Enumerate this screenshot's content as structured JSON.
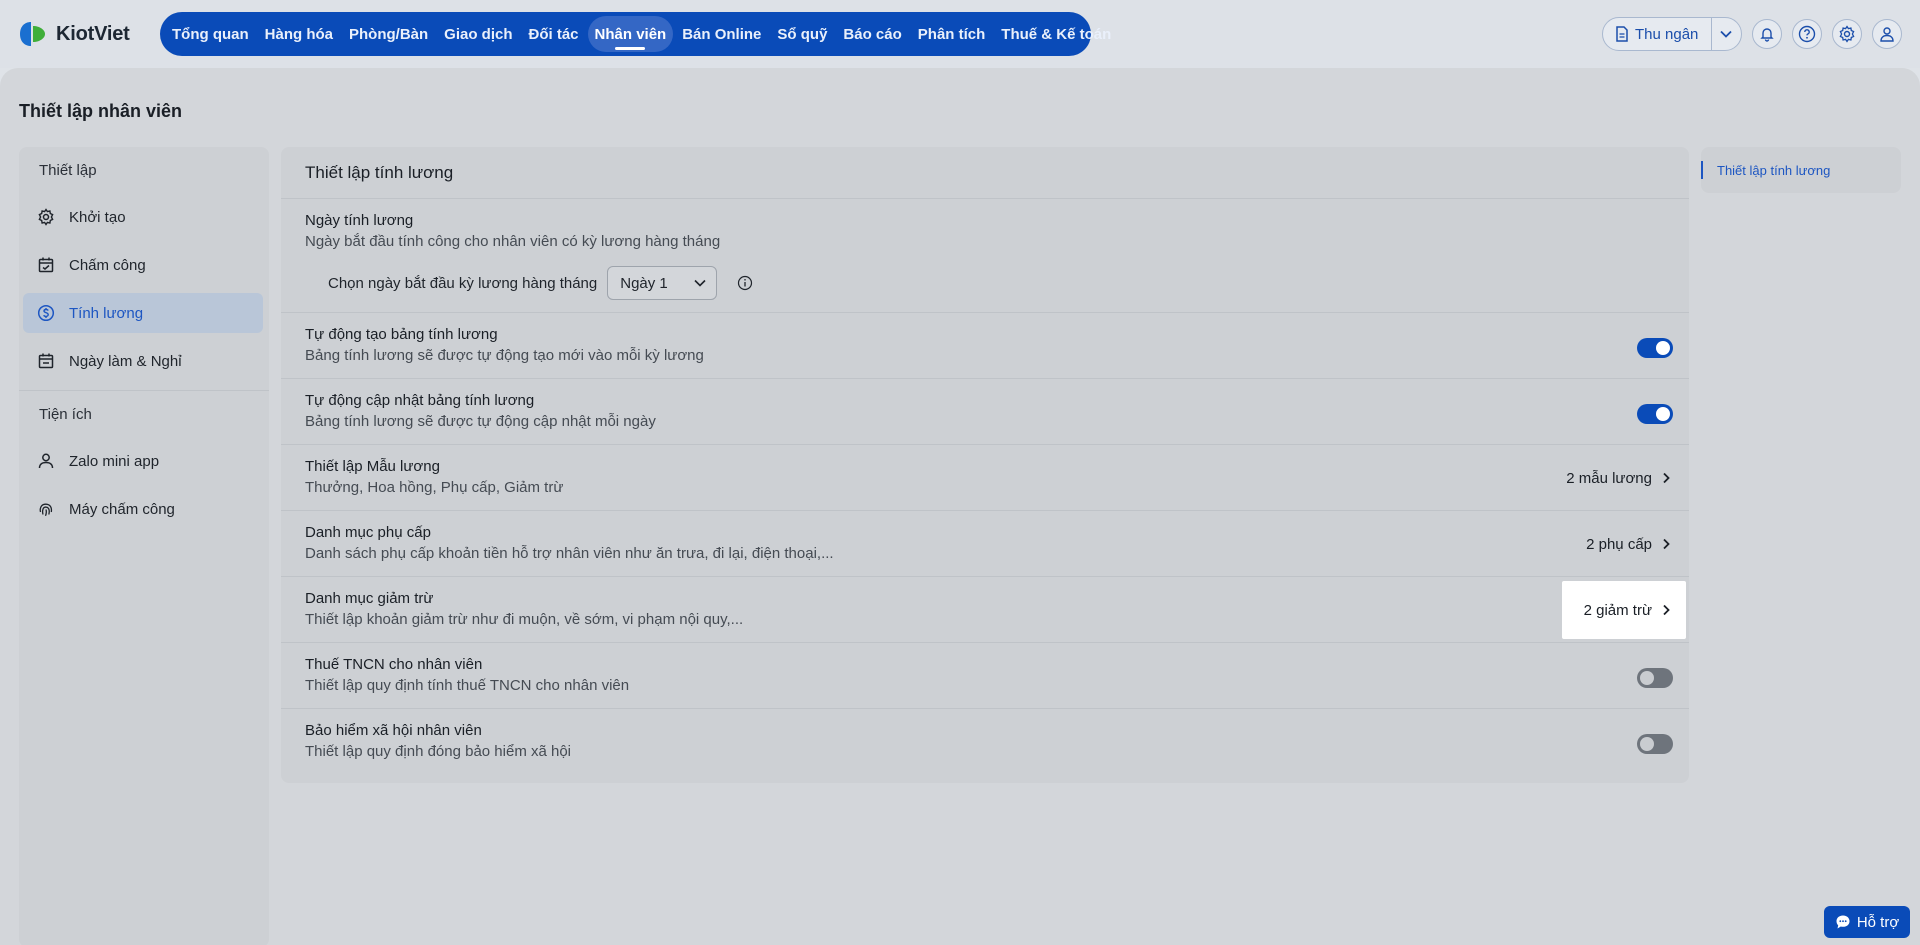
{
  "app": {
    "brand": "KiotViet"
  },
  "nav": {
    "items": [
      {
        "label": "Tổng quan"
      },
      {
        "label": "Hàng hóa"
      },
      {
        "label": "Phòng/Bàn"
      },
      {
        "label": "Giao dịch"
      },
      {
        "label": "Đối tác"
      },
      {
        "label": "Nhân viên",
        "active": true
      },
      {
        "label": "Bán Online"
      },
      {
        "label": "Sổ quỹ"
      },
      {
        "label": "Báo cáo"
      },
      {
        "label": "Phân tích"
      },
      {
        "label": "Thuế & Kế toán"
      }
    ]
  },
  "toolbar": {
    "cashier_label": "Thu ngân",
    "icons": [
      "bell-icon",
      "help-icon",
      "gear-icon",
      "user-icon"
    ]
  },
  "page": {
    "title": "Thiết lập nhân viên"
  },
  "sidebar": {
    "section_setup": "Thiết lập",
    "setup_items": [
      {
        "label": "Khởi tạo",
        "icon": "gear-icon"
      },
      {
        "label": "Chấm công",
        "icon": "calendar-check-icon"
      },
      {
        "label": "Tính lương",
        "icon": "dollar-circle-icon",
        "active": true
      },
      {
        "label": "Ngày làm & Nghỉ",
        "icon": "calendar-icon"
      }
    ],
    "section_utilities": "Tiện ích",
    "utility_items": [
      {
        "label": "Zalo mini app",
        "icon": "user-icon"
      },
      {
        "label": "Máy chấm công",
        "icon": "fingerprint-icon"
      }
    ]
  },
  "payroll": {
    "header": "Thiết lập tính lương",
    "payday": {
      "title": "Ngày tính lương",
      "desc": "Ngày bắt đầu tính công cho nhân viên có kỳ lương hàng tháng",
      "select_label": "Chọn ngày bắt đầu kỳ lương hàng tháng",
      "select_value": "Ngày 1"
    },
    "auto_create": {
      "title": "Tự động tạo bảng tính lương",
      "desc": "Bảng tính lương sẽ được tự động tạo mới vào mỗi kỳ lương",
      "enabled": true
    },
    "auto_update": {
      "title": "Tự động cập nhật bảng tính lương",
      "desc": "Bảng tính lương sẽ được tự động cập nhật mỗi ngày",
      "enabled": true
    },
    "templates": {
      "title": "Thiết lập Mẫu lương",
      "desc": "Thưởng, Hoa hồng, Phụ cấp, Giảm trừ",
      "action": "2 mẫu lương"
    },
    "allowances": {
      "title": "Danh mục phụ cấp",
      "desc": "Danh sách phụ cấp khoản tiền hỗ trợ nhân viên như ăn trưa, đi lại, điện thoại,...",
      "action": "2 phụ cấp"
    },
    "deductions": {
      "title": "Danh mục giảm trừ",
      "desc": "Thiết lập khoản giảm trừ như đi muộn, về sớm, vi phạm nội quy,...",
      "action": "2 giảm trừ"
    },
    "income_tax": {
      "title": "Thuế TNCN cho nhân viên",
      "desc": "Thiết lập quy định tính thuế TNCN cho nhân viên",
      "enabled": false
    },
    "insurance": {
      "title": "Bảo hiểm xã hội nhân viên",
      "desc": "Thiết lập quy định đóng bảo hiểm xã hội",
      "enabled": false
    }
  },
  "anchor": {
    "label": "Thiết lập tính lương"
  },
  "support": {
    "label": "Hỗ trợ"
  },
  "colors": {
    "primary": "#0a4bb8",
    "active_text": "#1d56c2"
  }
}
